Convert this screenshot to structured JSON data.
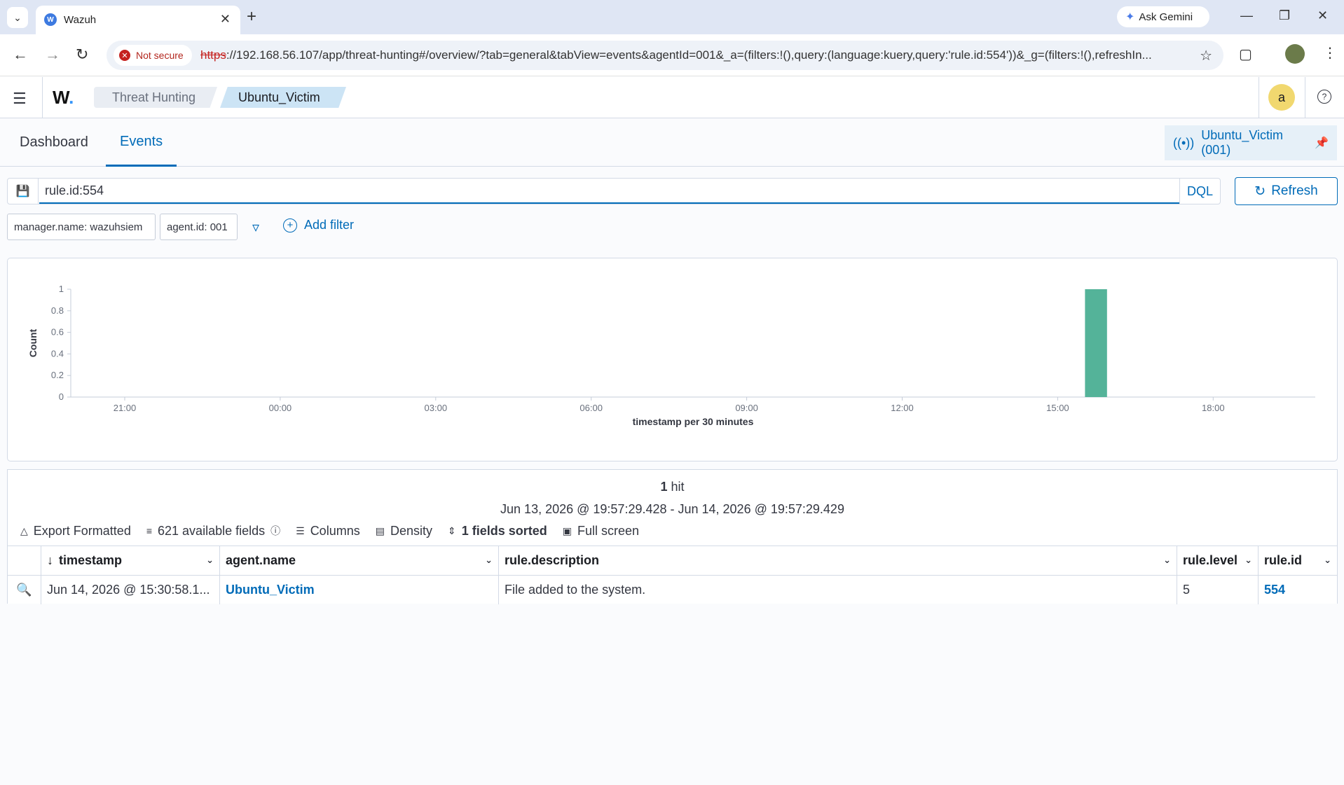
{
  "browser": {
    "tab_title": "Wazuh",
    "favicon_letter": "W",
    "new_tab": "+",
    "gemini_label": "Ask Gemini",
    "security_label": "Not secure",
    "url_scheme": "https",
    "url_rest": "://192.168.56.107/app/threat-hunting#/overview/?tab=general&tabView=events&agentId=001&_a=(filters:!(),query:(language:kuery,query:'rule.id:554'))&_g=(filters:!(),refreshIn..."
  },
  "header": {
    "logo_text": "W",
    "logo_dot": ".",
    "breadcrumbs": [
      "Threat Hunting",
      "Ubuntu_Victim"
    ],
    "avatar_letter": "a",
    "help_glyph": "?"
  },
  "tabs": [
    "Dashboard",
    "Events"
  ],
  "pinned_agent": "Ubuntu_Victim (001)",
  "query": {
    "value": "rule.id:554",
    "language": "DQL",
    "refresh_label": "Refresh"
  },
  "filters": {
    "pills": [
      "manager.name: wazuhsiem",
      "agent.id: 001"
    ],
    "add_label": "Add filter"
  },
  "chart_data": {
    "type": "bar",
    "title": "",
    "xlabel": "timestamp per 30 minutes",
    "ylabel": "Count",
    "ylim": [
      0,
      1
    ],
    "yticks": [
      "0",
      "0.2",
      "0.4",
      "0.6",
      "0.8",
      "1"
    ],
    "x_ticks": [
      "21:00",
      "00:00",
      "03:00",
      "06:00",
      "09:00",
      "12:00",
      "15:00",
      "18:00"
    ],
    "bars": [
      {
        "x": "15:30",
        "value": 1
      }
    ],
    "color": "#54b399",
    "grid": false
  },
  "results": {
    "hit_count": "1",
    "hit_label": " hit",
    "time_range": "Jun 13, 2026 @ 19:57:29.428 - Jun 14, 2026 @ 19:57:29.429",
    "toolbar": {
      "export": "Export Formatted",
      "fields": "621 available fields",
      "columns": "Columns",
      "density": "Density",
      "sorted": "1 fields sorted",
      "fullscreen": "Full screen"
    },
    "columns": [
      "timestamp",
      "agent.name",
      "rule.description",
      "rule.level",
      "rule.id"
    ],
    "rows": [
      [
        "Jun 14, 2026 @ 15:30:58.1...",
        "Ubuntu_Victim",
        "File added to the system.",
        "5",
        "554"
      ]
    ]
  }
}
